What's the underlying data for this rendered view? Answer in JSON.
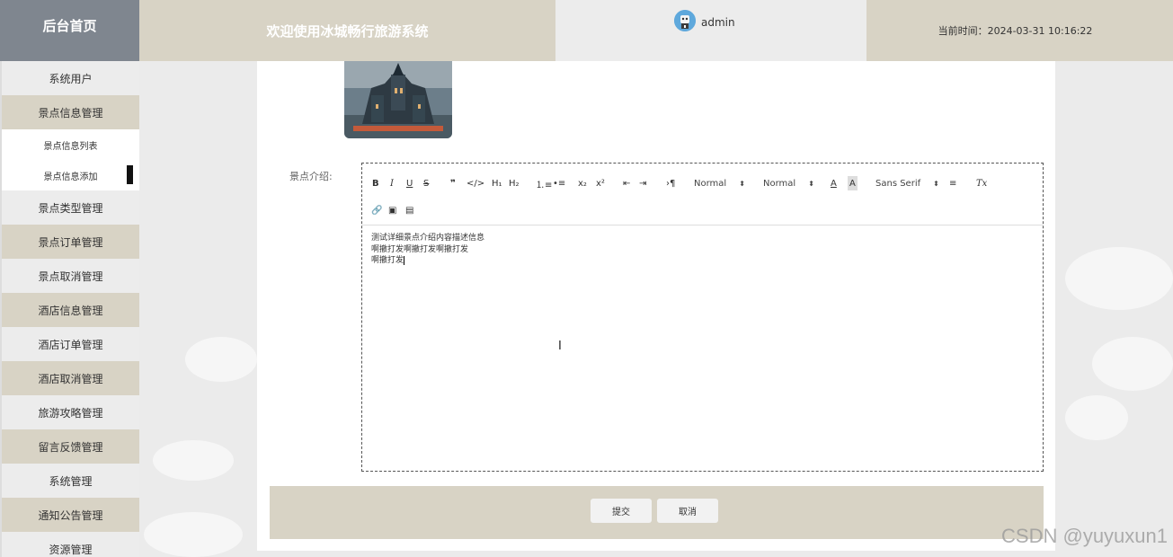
{
  "header": {
    "logo": "后台首页",
    "title": "欢迎使用冰城畅行旅游系统",
    "username": "admin",
    "time_label": "当前时间：",
    "time_value": "2024-03-31 10:16:22"
  },
  "sidebar": {
    "items": [
      {
        "label": "系统用户"
      },
      {
        "label": "景点信息管理"
      },
      {
        "label": "景点信息列表"
      },
      {
        "label": "景点信息添加"
      },
      {
        "label": "景点类型管理"
      },
      {
        "label": "景点订单管理"
      },
      {
        "label": "景点取消管理"
      },
      {
        "label": "酒店信息管理"
      },
      {
        "label": "酒店订单管理"
      },
      {
        "label": "酒店取消管理"
      },
      {
        "label": "旅游攻略管理"
      },
      {
        "label": "留言反馈管理"
      },
      {
        "label": "系统管理"
      },
      {
        "label": "通知公告管理"
      },
      {
        "label": "资源管理"
      }
    ]
  },
  "form": {
    "intro_label": "景点介绍:",
    "editor": {
      "toolbar": {
        "header_select": "Normal",
        "size_select": "Normal",
        "font_select": "Sans Serif",
        "h1": "H₁",
        "h2": "H₂",
        "sub": "x₂",
        "sup": "x²"
      },
      "lines": [
        "测试详细景点介绍内容描述信息",
        "啊撤打发啊撤打发啊撤打发",
        "啊撤打发"
      ]
    },
    "submit_label": "提交",
    "cancel_label": "取消"
  },
  "watermark": "CSDN @yuyuxun1"
}
